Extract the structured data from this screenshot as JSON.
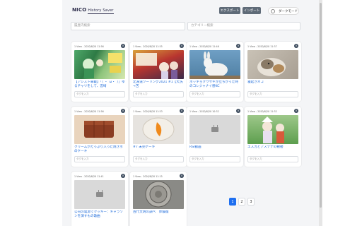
{
  "header": {
    "logo_main": "NICO",
    "logo_sub": "History Saver",
    "export_label": "エクスポート",
    "import_label": "インポート",
    "dark_mode_label": "ダークモード"
  },
  "search": {
    "title_placeholder": "履歴内検索",
    "category_placeholder": "カテゴリー検索"
  },
  "cards": [
    {
      "meta": "1 View - 2020/8/20 11:56",
      "title": "【アシスト車載】「（ ・`ω・´）」ゆるチャリをして、宮崎",
      "tag": "タグを入力"
    },
    {
      "meta": "1 View - 2020/8/20 11:55",
      "title": "北海道ツーリング2021 #1【大洗→苫",
      "tag": "タグを入力"
    },
    {
      "meta": "1 View - 2020/8/20 11:46",
      "title": "ホッキョクウサギが立ちがった時のコレジャナイ感KC",
      "tag": "タグを入力"
    },
    {
      "meta": "1 View - 2020/8/20 11:37",
      "title": "寝起きネコ",
      "tag": "タグを入力"
    },
    {
      "meta": "1 View - 2020/8/20 11:56",
      "title": "クリームがたっぷり入った焼きホのケーキ",
      "tag": "タグを入力"
    },
    {
      "meta": "1 View - 2020/8/20 11:53",
      "title": "#7 未完ケーキ",
      "tag": "タグを入力"
    },
    {
      "meta": "1 View - 2020/8/20 10:32",
      "title": "RSI動画",
      "tag": "タグを入力"
    },
    {
      "meta": "1 View - 2020/8/20 11:32",
      "title": "エスカとアステナの敷楼",
      "tag": "タグを入力"
    },
    {
      "meta": "1 View - 2020/8/20 11:41",
      "title": "公司の電源でクッキー：キャラソンを演すもの歌曲",
      "tag": "タグを入力"
    },
    {
      "meta": "1 View - 2020/8/20 11:15",
      "title": "古代文明の調べ　体験版",
      "tag": "タグを入力"
    }
  ],
  "pagination": {
    "pages": [
      "1",
      "2",
      "3"
    ],
    "current": "1"
  },
  "colors": {
    "accent": "#1e6ff0",
    "link": "#1565d8",
    "button": "#5f6b78"
  }
}
